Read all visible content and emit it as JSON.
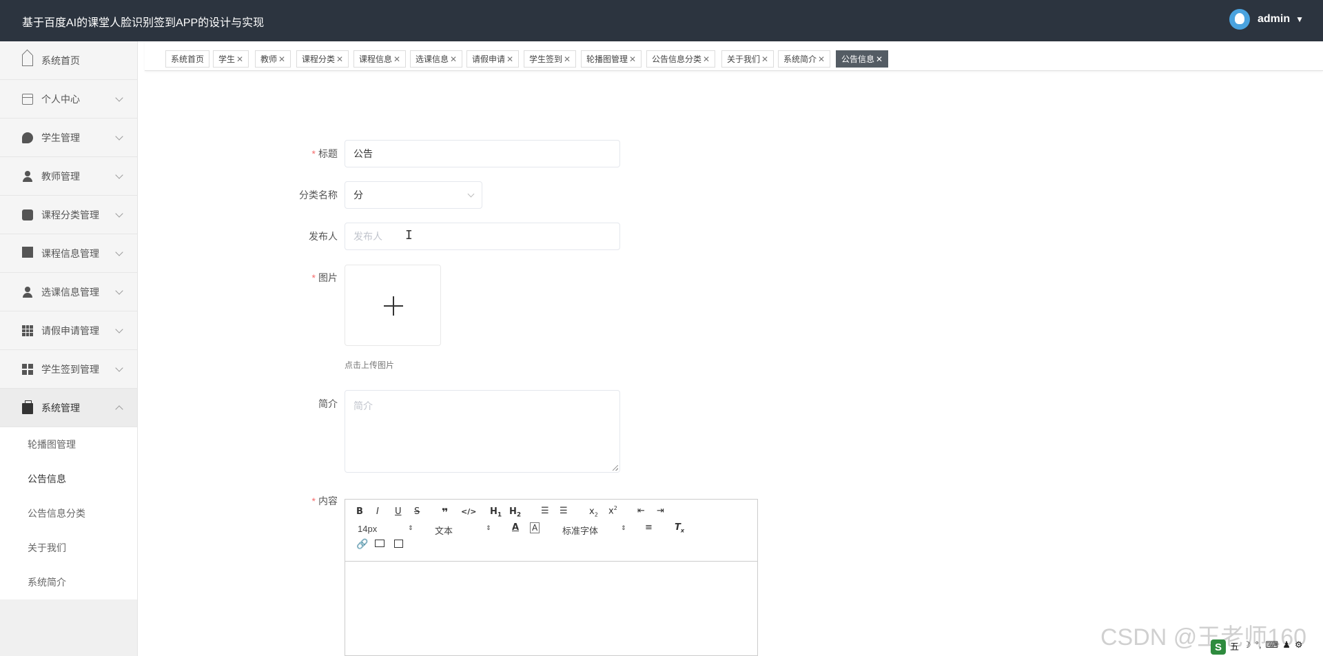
{
  "header": {
    "title": "基于百度AI的课堂人脸识别签到APP的设计与实现",
    "user": "admin"
  },
  "sidebar": {
    "items": [
      {
        "label": "系统首页",
        "icon": "home-icon"
      },
      {
        "label": "个人中心",
        "icon": "id-card-icon"
      },
      {
        "label": "学生管理",
        "icon": "leaf-icon"
      },
      {
        "label": "教师管理",
        "icon": "person-icon"
      },
      {
        "label": "课程分类管理",
        "icon": "clipboard-icon"
      },
      {
        "label": "课程信息管理",
        "icon": "monitor-icon"
      },
      {
        "label": "选课信息管理",
        "icon": "user-icon"
      },
      {
        "label": "请假申请管理",
        "icon": "grid-icon"
      },
      {
        "label": "学生签到管理",
        "icon": "tiles-icon"
      },
      {
        "label": "系统管理",
        "icon": "briefcase-icon"
      }
    ],
    "subitems": [
      "轮播图管理",
      "公告信息",
      "公告信息分类",
      "关于我们",
      "系统简介"
    ]
  },
  "tabs": [
    "系统首页",
    "学生",
    "教师",
    "课程分类",
    "课程信息",
    "选课信息",
    "请假申请",
    "学生签到",
    "轮播图管理",
    "公告信息分类",
    "关于我们",
    "系统简介",
    "公告信息"
  ],
  "form": {
    "title": {
      "label": "标题",
      "value": "公告"
    },
    "category": {
      "label": "分类名称",
      "value": "分"
    },
    "publisher": {
      "label": "发布人",
      "placeholder": "发布人"
    },
    "image": {
      "label": "图片",
      "hint": "点击上传图片"
    },
    "intro": {
      "label": "简介",
      "placeholder": "简介"
    },
    "content": {
      "label": "内容"
    }
  },
  "editor": {
    "font_size": "14px",
    "block_type": "文本",
    "font_family": "标准字体"
  },
  "watermark": "CSDN @王老师160",
  "tray": [
    "五",
    "☽",
    "°,",
    "⌨",
    "♟",
    "⚙"
  ],
  "colors": {
    "topbar": "#2c343f",
    "active_tab": "#545c64",
    "required": "#f56c6c"
  }
}
